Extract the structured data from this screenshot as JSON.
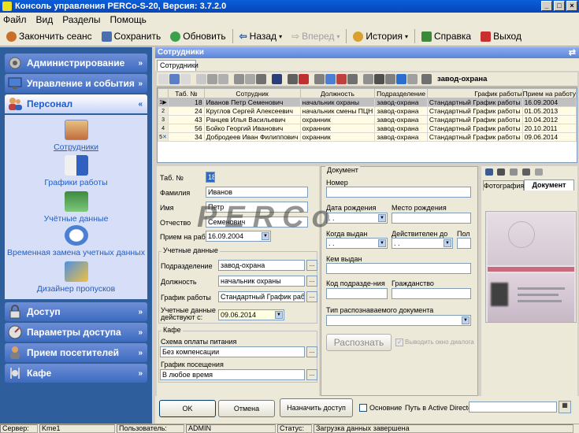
{
  "window": {
    "title": "Консоль управления PERCo-S-20, Версия: 3.7.2.0"
  },
  "menu": [
    "Файл",
    "Вид",
    "Разделы",
    "Помощь"
  ],
  "toolbar": {
    "end_session": "Закончить сеанс",
    "save": "Сохранить",
    "refresh": "Обновить",
    "back": "Назад",
    "forward": "Вперед",
    "history": "История",
    "help": "Справка",
    "exit": "Выход"
  },
  "sidebar": {
    "sections": [
      "Администрирование",
      "Управление и события",
      "Персонал",
      "Доступ",
      "Параметры доступа",
      "Прием посетителей",
      "Кафе"
    ],
    "personnel_items": [
      "Сотрудники",
      "Графики работы",
      "Учётные данные",
      "Временная замена учетных данных",
      "Дизайнер пропусков"
    ]
  },
  "main": {
    "header": "Сотрудники",
    "tab": "Сотрудники",
    "filter": "завод-охрана"
  },
  "grid": {
    "columns": [
      "Таб. №",
      "Сотрудник",
      "Должность",
      "Подразделение",
      "График работы",
      "Прием на работу"
    ],
    "rows": [
      [
        "1",
        "18",
        "Иванов Петр Семенович",
        "начальник охраны",
        "завод-охрана",
        "Стандартный График работы",
        "16.09.2004"
      ],
      [
        "2",
        "24",
        "Круглов Сергей Алексеевич",
        "начальник смены ПЦН",
        "завод-охрана",
        "Стандартный График работы",
        "01.05.2013"
      ],
      [
        "3",
        "43",
        "Ранцев Илья Васильевич",
        "охранник",
        "завод-охрана",
        "Стандартный График работы",
        "10.04.2012"
      ],
      [
        "4",
        "56",
        "Бойко Георгий Иванович",
        "охранник",
        "завод-охрана",
        "Стандартный График работы",
        "20.10.2011"
      ],
      [
        "5",
        "34",
        "Добродеев Иван Филиппович",
        "охранник",
        "завод-охрана",
        "Стандартный График работы",
        "09.06.2014"
      ]
    ]
  },
  "form": {
    "tab_no_label": "Таб. №",
    "tab_no": "18",
    "lastname_label": "Фамилия",
    "lastname": "Иванов",
    "firstname_label": "Имя",
    "firstname": "Петр",
    "patronymic_label": "Отчество",
    "patronymic": "Семенович",
    "hire_label": "Прием на работу",
    "hire": "16.09.2004",
    "accounts_group": "Учетные данные",
    "department_label": "Подразделение",
    "department": "завод-охрана",
    "position_label": "Должность",
    "position": "начальник охраны",
    "schedule_label": "График работы",
    "schedule": "Стандартный График работы",
    "valid_label": "Учетные данные действуют с:",
    "valid": "09.06.2014",
    "cafe_group": "Кафе",
    "payment_label": "Схема оплаты питания",
    "payment": "Без компенсации",
    "visits_label": "График посещения",
    "visits": "В любое время"
  },
  "document": {
    "group": "Документ",
    "number_label": "Номер",
    "birthdate_label": "Дата рождения",
    "birthdate": ". .",
    "birthplace_label": "Место рождения",
    "issued_label": "Когда выдан",
    "issued": ". .",
    "valid_until_label": "Действителен до",
    "valid_until": ". .",
    "sex_label": "Пол",
    "issued_by_label": "Кем выдан",
    "dept_code_label": "Код подразде-ния",
    "citizenship_label": "Гражданство",
    "recognized_type_label": "Тип распознаваемого документа",
    "recognize_button": "Распознать",
    "show_dialog": "Выводить окно диалога"
  },
  "photo_tabs": [
    "Фотография",
    "Документ"
  ],
  "buttons": {
    "ok": "OK",
    "cancel": "Отмена",
    "assign_pass": "Назначить доступ",
    "primary": "Основние",
    "ad_path": "Путь в Active Directory"
  },
  "status": {
    "server_label": "Сервер:",
    "server": "Kme1",
    "user_label": "Пользователь:",
    "user": "ADMIN",
    "status_label": "Статус:",
    "status": "Загрузка данных завершена"
  }
}
